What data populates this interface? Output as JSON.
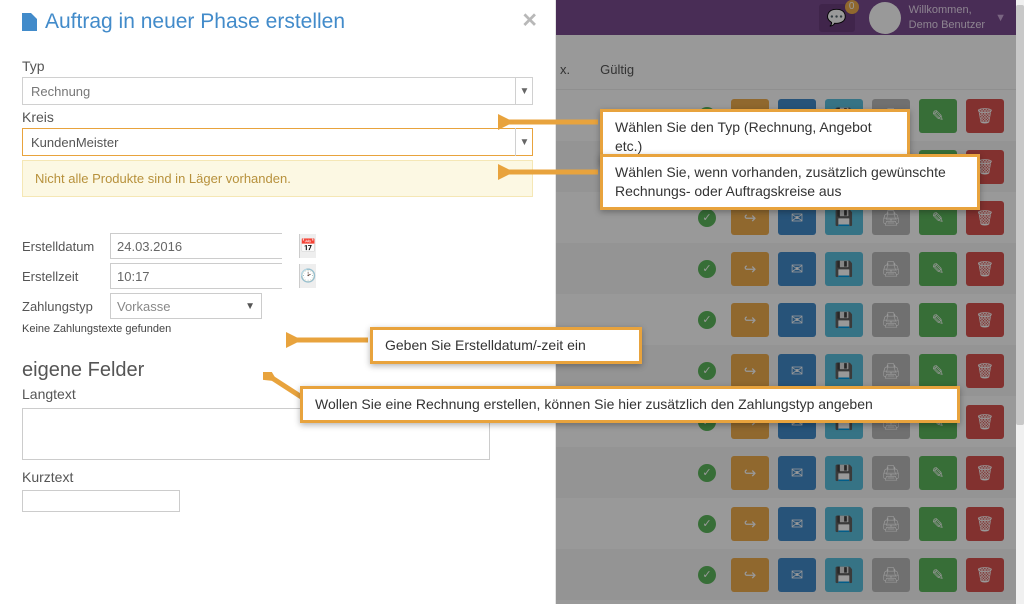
{
  "app": {
    "welcome_label": "Willkommen,",
    "welcome_user": "Demo Benutzer",
    "badge_count": "0"
  },
  "bg_header": {
    "col_x": "x.",
    "col_valid": "Gültig"
  },
  "modal": {
    "title": "Auftrag in neuer Phase erstellen",
    "typ_label": "Typ",
    "typ_value": "Rechnung",
    "kreis_label": "Kreis",
    "kreis_value": "KundenMeister",
    "warning": "Nicht alle Produkte sind in Läger vorhanden.",
    "erstelldatum_label": "Erstelldatum",
    "erstelldatum_value": "24.03.2016",
    "erstellzeit_label": "Erstellzeit",
    "erstellzeit_value": "10:17",
    "zahlungstyp_label": "Zahlungstyp",
    "zahlungstyp_value": "Vorkasse",
    "zahlung_note": "Keine Zahlungstexte gefunden",
    "eigene_felder": "eigene Felder",
    "langtext_label": "Langtext",
    "kurztext_label": "Kurztext"
  },
  "annotations": {
    "typ": "Wählen Sie den Typ (Rechnung, Angebot etc.)",
    "kreis": "Wählen Sie, wenn vorhanden, zusätzlich gewünschte Rechnungs- oder Auftragskreise aus",
    "datum": "Geben Sie Erstelldatum/-zeit ein",
    "zahlung": "Wollen Sie eine Rechnung erstellen, können Sie hier zusätzlich den Zahlungstyp angeben"
  },
  "row_icons": [
    "share",
    "mail",
    "save",
    "print",
    "edit",
    "delete"
  ]
}
